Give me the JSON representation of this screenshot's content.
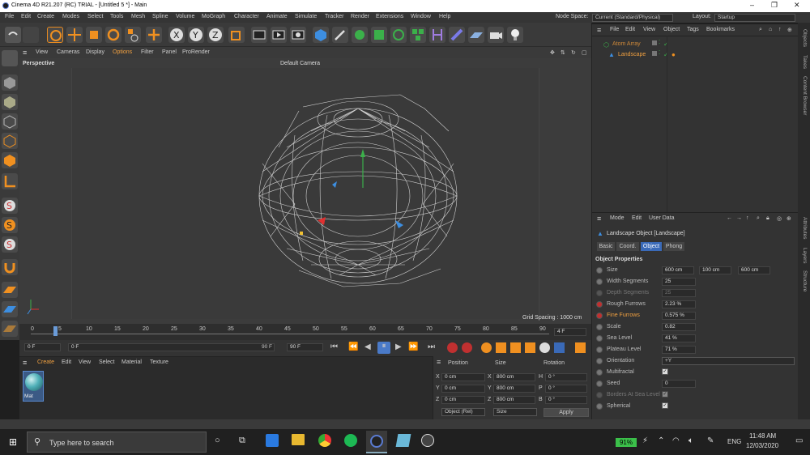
{
  "window": {
    "title": "Cinema 4D R21.207 (RC) TRIAL - [Untitled 5 *] - Main"
  },
  "menu": {
    "items": [
      "File",
      "Edit",
      "Create",
      "Modes",
      "Select",
      "Tools",
      "Mesh",
      "Spline",
      "Volume",
      "MoGraph",
      "Character",
      "Animate",
      "Simulate",
      "Tracker",
      "Render",
      "Extensions",
      "Window",
      "Help"
    ],
    "node_space_label": "Node Space:",
    "node_space_value": "Current (Standard/Physical)",
    "layout_label": "Layout:",
    "layout_value": "Startup"
  },
  "viewport": {
    "menu": [
      "View",
      "Cameras",
      "Display",
      "Options",
      "Filter",
      "Panel",
      "ProRender"
    ],
    "label": "Perspective",
    "camera": "Default Camera",
    "grid_spacing": "Grid Spacing : 1000 cm"
  },
  "timeline": {
    "ticks": [
      "0",
      "5",
      "10",
      "15",
      "20",
      "25",
      "30",
      "35",
      "40",
      "45",
      "50",
      "55",
      "60",
      "65",
      "70",
      "75",
      "80",
      "85",
      "90"
    ],
    "current_frame_box": "4 F",
    "start": "0 F",
    "current": "0 F",
    "end_a": "90 F",
    "end_b": "90 F"
  },
  "material": {
    "menu": [
      "Create",
      "Edit",
      "View",
      "Select",
      "Material",
      "Texture"
    ],
    "swatch_label": "Mat"
  },
  "coords": {
    "headers": [
      "Position",
      "Size",
      "Rotation"
    ],
    "rows": [
      {
        "axis": "X",
        "pos": "0 cm",
        "saxis": "X",
        "size": "800 cm",
        "raxis": "H",
        "rot": "0 °"
      },
      {
        "axis": "Y",
        "pos": "0 cm",
        "saxis": "Y",
        "size": "800 cm",
        "raxis": "P",
        "rot": "0 °"
      },
      {
        "axis": "Z",
        "pos": "0 cm",
        "saxis": "Z",
        "size": "800 cm",
        "raxis": "B",
        "rot": "0 °"
      }
    ],
    "mode": "Object (Rel)",
    "size_mode": "Size",
    "apply": "Apply"
  },
  "objects": {
    "menu": [
      "File",
      "Edit",
      "View",
      "Object",
      "Tags",
      "Bookmarks"
    ],
    "items": [
      {
        "name": "Atom Array"
      },
      {
        "name": "Landscape"
      }
    ]
  },
  "attributes": {
    "menu": [
      "Mode",
      "Edit",
      "User Data"
    ],
    "object_title": "Landscape Object [Landscape]",
    "tabs": [
      "Basic",
      "Coord.",
      "Object",
      "Phong"
    ],
    "section": "Object Properties",
    "size_label": "Size",
    "size": [
      "600 cm",
      "100 cm",
      "600 cm"
    ],
    "width_segments_label": "Width Segments",
    "width_segments": "25",
    "depth_segments_label": "Depth Segments",
    "depth_segments": "25",
    "rough_label": "Rough Furrows",
    "rough": "2.23 %",
    "fine_label": "Fine Furrows",
    "fine": "0.575 %",
    "scale_label": "Scale",
    "scale": "0.82",
    "sea_label": "Sea Level",
    "sea": "41 %",
    "plateau_label": "Plateau Level",
    "plateau": "71 %",
    "orientation_label": "Orientation",
    "orientation": "+Y",
    "multifractal_label": "Multifractal",
    "seed_label": "Seed",
    "seed": "0",
    "borders_label": "Borders At Sea Level",
    "spherical_label": "Spherical"
  },
  "side_tabs": [
    "Objects",
    "Takes",
    "Content Browser",
    "Attributes",
    "Layers",
    "Structure"
  ],
  "taskbar": {
    "search_placeholder": "Type here to search",
    "battery": "91%",
    "lang": "ENG",
    "time": "11:48 AM",
    "date": "12/03/2020"
  }
}
